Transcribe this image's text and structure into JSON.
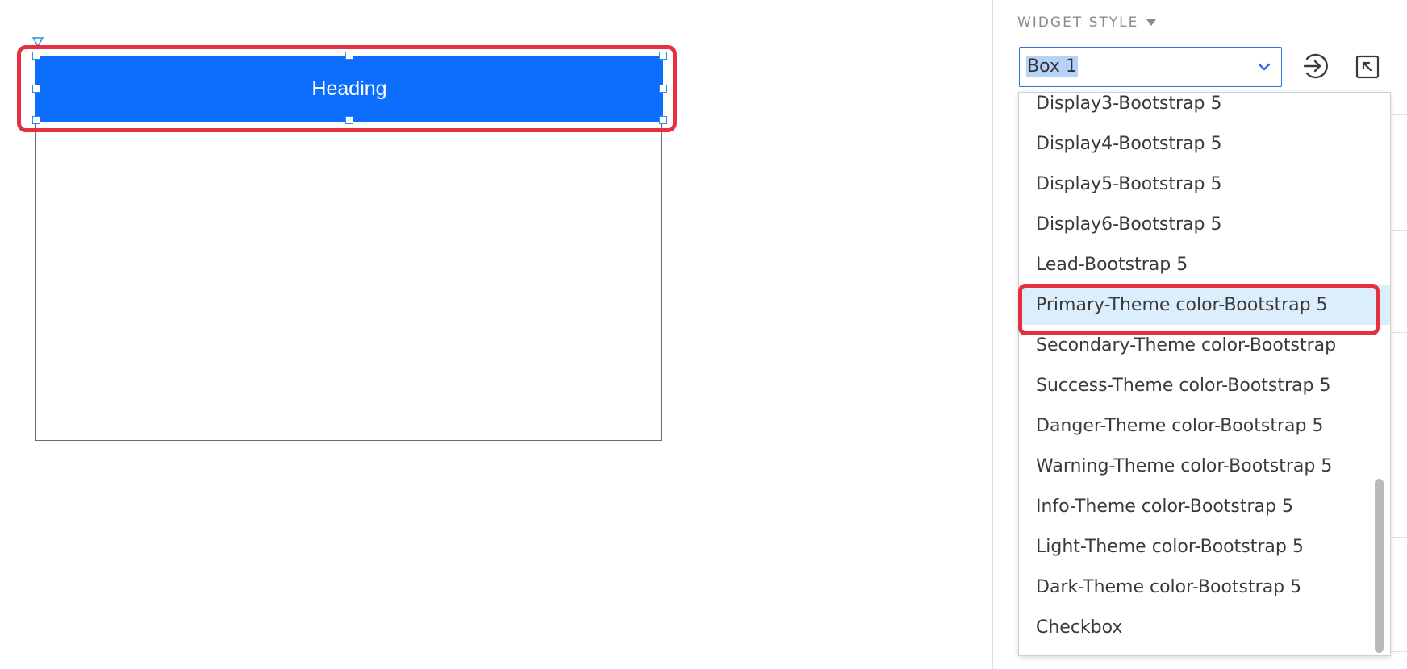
{
  "canvas": {
    "heading_text": "Heading",
    "heading_color": "#0d6efd",
    "highlight_color": "#e5303f"
  },
  "panel": {
    "title": "WIDGET STYLE",
    "title_caret_icon": "caret-down-icon",
    "select": {
      "value": "Box 1",
      "chevron_icon": "chevron-down-icon"
    },
    "buttons": [
      {
        "name": "apply-style-icon"
      },
      {
        "name": "reset-style-icon"
      }
    ]
  },
  "dropdown": {
    "items": [
      {
        "label": "Display3-Bootstrap 5",
        "selected": false
      },
      {
        "label": "Display4-Bootstrap 5",
        "selected": false
      },
      {
        "label": "Display5-Bootstrap 5",
        "selected": false
      },
      {
        "label": "Display6-Bootstrap 5",
        "selected": false
      },
      {
        "label": "Lead-Bootstrap 5",
        "selected": false
      },
      {
        "label": "Primary-Theme color-Bootstrap 5",
        "selected": true
      },
      {
        "label": "Secondary-Theme color-Bootstrap",
        "selected": false
      },
      {
        "label": "Success-Theme color-Bootstrap 5",
        "selected": false
      },
      {
        "label": "Danger-Theme color-Bootstrap 5",
        "selected": false
      },
      {
        "label": "Warning-Theme color-Bootstrap 5",
        "selected": false
      },
      {
        "label": "Info-Theme color-Bootstrap 5",
        "selected": false
      },
      {
        "label": "Light-Theme color-Bootstrap 5",
        "selected": false
      },
      {
        "label": "Dark-Theme color-Bootstrap 5",
        "selected": false
      },
      {
        "label": "Checkbox",
        "selected": false
      }
    ]
  }
}
